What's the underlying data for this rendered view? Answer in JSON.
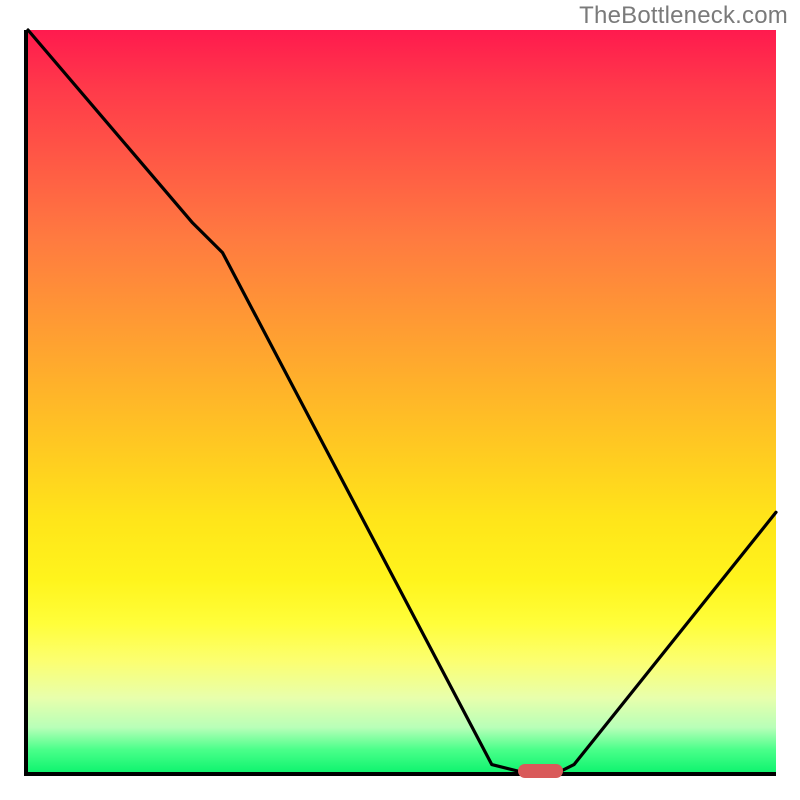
{
  "watermark": "TheBottleneck.com",
  "chart_data": {
    "type": "line",
    "title": "",
    "xlabel": "",
    "ylabel": "",
    "xlim": [
      0,
      100
    ],
    "ylim": [
      0,
      100
    ],
    "x": [
      0,
      22,
      26,
      62,
      66,
      71,
      73,
      100
    ],
    "values": [
      100,
      74,
      70,
      1,
      0,
      0,
      1,
      35
    ],
    "marker": {
      "x_start": 66,
      "x_end": 71,
      "y": 0
    },
    "gradient_stops": [
      {
        "pos": 0,
        "color": "#ff1a4e"
      },
      {
        "pos": 50,
        "color": "#ffb22a"
      },
      {
        "pos": 80,
        "color": "#fffe3a"
      },
      {
        "pos": 100,
        "color": "#10f46f"
      }
    ]
  }
}
